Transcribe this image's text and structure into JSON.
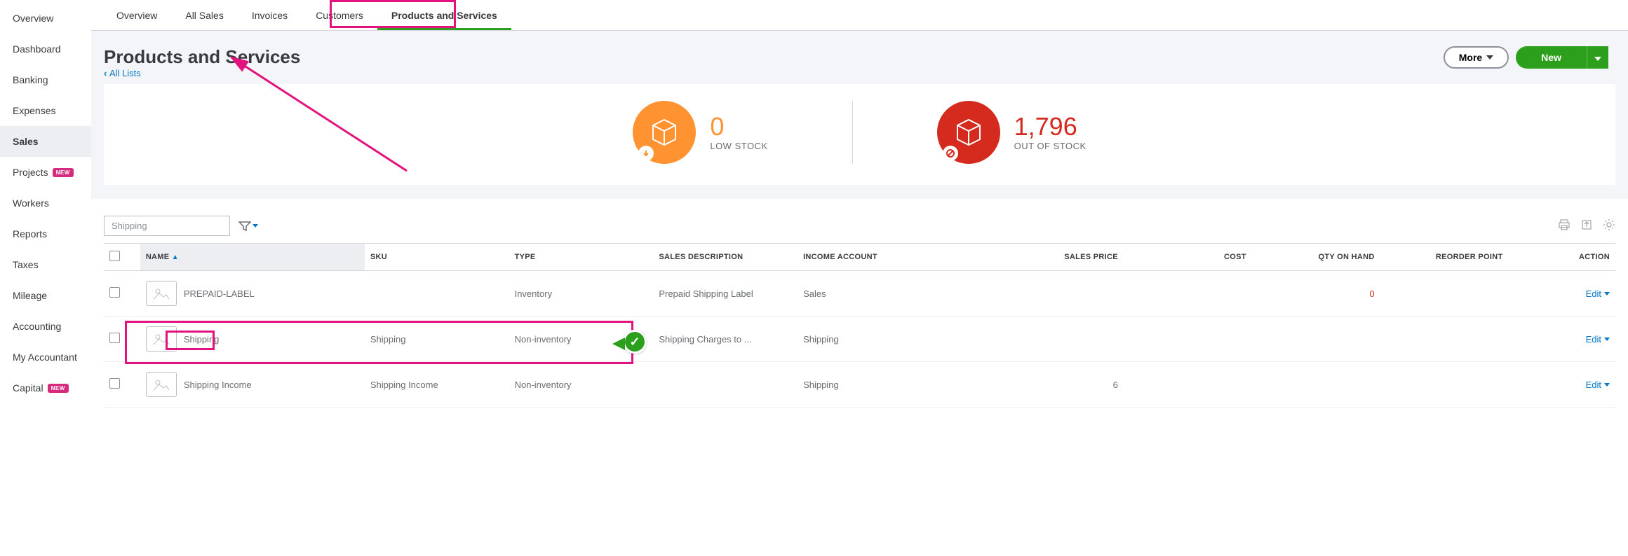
{
  "sidebar": {
    "items": [
      {
        "label": "Overview",
        "badge": null
      },
      {
        "label": "Dashboard",
        "badge": null
      },
      {
        "label": "Banking",
        "badge": null
      },
      {
        "label": "Expenses",
        "badge": null
      },
      {
        "label": "Sales",
        "badge": null,
        "active": true
      },
      {
        "label": "Projects",
        "badge": "NEW"
      },
      {
        "label": "Workers",
        "badge": null
      },
      {
        "label": "Reports",
        "badge": null
      },
      {
        "label": "Taxes",
        "badge": null
      },
      {
        "label": "Mileage",
        "badge": null
      },
      {
        "label": "Accounting",
        "badge": null
      },
      {
        "label": "My Accountant",
        "badge": null
      },
      {
        "label": "Capital",
        "badge": "NEW"
      }
    ]
  },
  "tabs": {
    "items": [
      "Overview",
      "All Sales",
      "Invoices",
      "Customers",
      "Products and Services"
    ],
    "active": 4
  },
  "header": {
    "title": "Products and Services",
    "back_link": "All Lists",
    "more_label": "More",
    "new_label": "New"
  },
  "stats": {
    "low_stock": {
      "value": "0",
      "label": "LOW STOCK"
    },
    "out_of_stock": {
      "value": "1,796",
      "label": "OUT OF STOCK"
    }
  },
  "search": {
    "value": "Shipping"
  },
  "columns": {
    "name": "NAME",
    "sku": "SKU",
    "type": "TYPE",
    "sales_desc": "SALES DESCRIPTION",
    "income_acct": "INCOME ACCOUNT",
    "sales_price": "SALES PRICE",
    "cost": "COST",
    "qty": "QTY ON HAND",
    "reorder": "REORDER POINT",
    "action": "ACTION"
  },
  "rows": [
    {
      "name": "PREPAID-LABEL",
      "sku": "",
      "type": "Inventory",
      "sales_desc": "Prepaid Shipping Label",
      "income_acct": "Sales",
      "sales_price": "",
      "cost": "",
      "qty": "0",
      "qty_red": true,
      "reorder": "",
      "action": "Edit"
    },
    {
      "name": "Shipping",
      "sku": "Shipping",
      "type": "Non-inventory",
      "sales_desc": "Shipping Charges to ...",
      "income_acct": "Shipping",
      "sales_price": "",
      "cost": "",
      "qty": "",
      "reorder": "",
      "action": "Edit"
    },
    {
      "name": "Shipping Income",
      "sku": "Shipping Income",
      "type": "Non-inventory",
      "sales_desc": "",
      "income_acct": "Shipping",
      "sales_price": "6",
      "cost": "",
      "qty": "",
      "reorder": "",
      "action": "Edit"
    }
  ]
}
